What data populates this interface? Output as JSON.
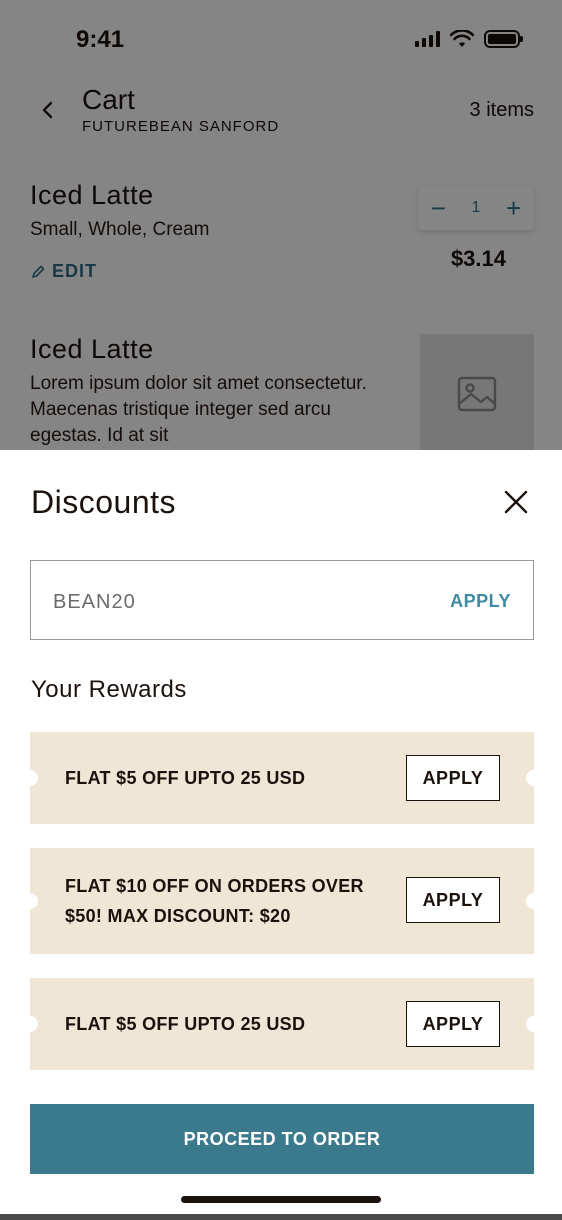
{
  "status_bar": {
    "time": "9:41"
  },
  "header": {
    "title": "Cart",
    "store": "FUTUREBEAN SANFORD",
    "item_count": "3 items"
  },
  "cart_items": [
    {
      "name": "Iced Latte",
      "options": "Small, Whole, Cream",
      "edit_label": "EDIT",
      "quantity": "1",
      "price": "$3.14"
    },
    {
      "name": "Iced Latte",
      "description": "Lorem ipsum dolor sit amet consectetur. Maecenas tristique integer sed arcu egestas. Id at sit"
    }
  ],
  "discounts": {
    "title": "Discounts",
    "promo_value": "BEAN20",
    "promo_apply": "APPLY",
    "rewards_title": "Your Rewards",
    "rewards": [
      {
        "text": "FLAT $5 OFF UPTO 25 USD",
        "apply": "APPLY"
      },
      {
        "text_line1": "FLAT $10 OFF ON ORDERS OVER",
        "text_line2": "$50! MAX DISCOUNT: $20",
        "apply": "APPLY"
      },
      {
        "text": "FLAT $5 OFF UPTO 25 USD",
        "apply": "APPLY"
      }
    ],
    "proceed": "PROCEED TO ORDER"
  },
  "colors": {
    "accent": "#3b7a8d",
    "link": "#3d8ba5",
    "reward_bg": "#efe6d6",
    "text": "#1b110d"
  },
  "icons": [
    "chevron-left-icon",
    "signal-icon",
    "wifi-icon",
    "battery-icon",
    "pencil-icon",
    "minus-icon",
    "plus-icon",
    "image-placeholder-icon",
    "close-icon"
  ]
}
